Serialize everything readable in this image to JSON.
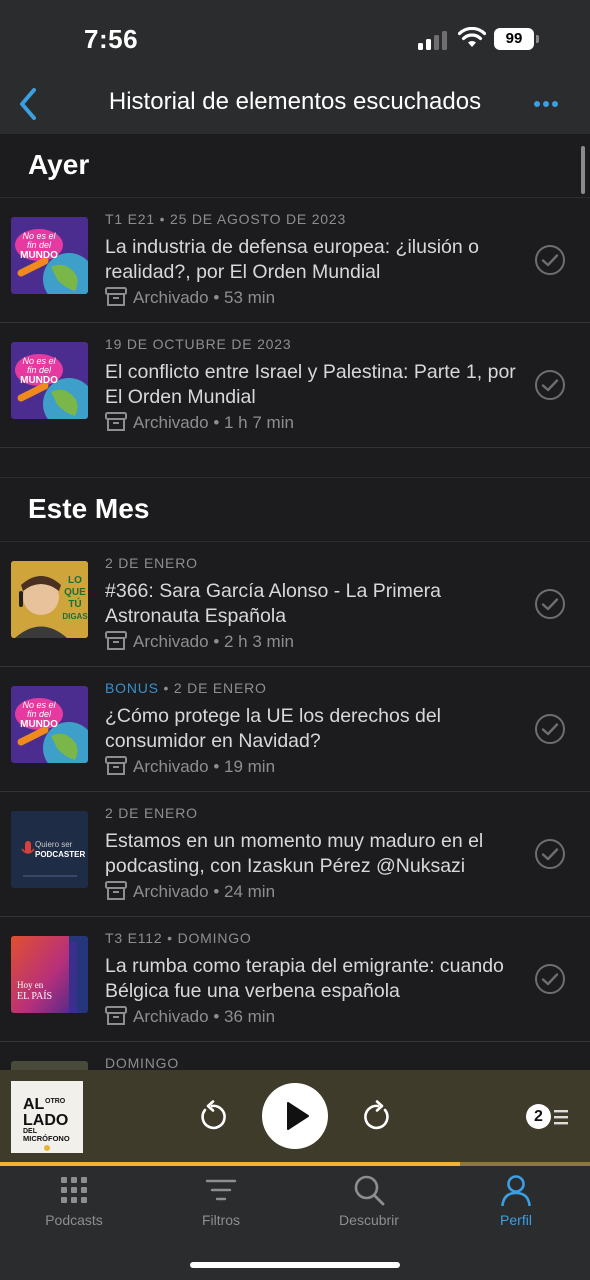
{
  "status_bar": {
    "time": "7:56",
    "battery": "99"
  },
  "header": {
    "title": "Historial de elementos escuchados"
  },
  "colors": {
    "accent": "#3b9fe3",
    "background": "#1c1c1e",
    "player_bg": "#3f3b2b",
    "progress": "#f2b233"
  },
  "sections": [
    {
      "title": "Ayer",
      "episodes": [
        {
          "meta": "T1 E21 • 25 DE AGOSTO DE 2023",
          "title": "La industria de defensa europea: ¿ilusión o realidad?, por El Orden Mundial",
          "status": "Archivado • 53 min",
          "artwork": "no-es-el-fin-del-mundo"
        },
        {
          "meta": "19 DE OCTUBRE DE 2023",
          "title": "El conflicto entre Israel y Palestina: Parte 1, por El Orden Mundial",
          "status": "Archivado • 1 h 7 min",
          "artwork": "no-es-el-fin-del-mundo"
        }
      ]
    },
    {
      "title": "Este Mes",
      "episodes": [
        {
          "meta": "2 DE ENERO",
          "title": "#366: Sara García Alonso - La Primera Astronauta Española",
          "status": "Archivado • 2 h 3 min",
          "artwork": "lo-que-tu-digas"
        },
        {
          "meta_prefix": "BONUS",
          "meta": " • 2 DE ENERO",
          "title": "¿Cómo protege la UE los derechos del consumidor en Navidad?",
          "status": "Archivado • 19 min",
          "artwork": "no-es-el-fin-del-mundo"
        },
        {
          "meta": "2 DE ENERO",
          "title": "Estamos en un momento muy maduro en el podcasting, con Izaskun Pérez @Nuksazi",
          "status": "Archivado • 24 min",
          "artwork": "quiero-ser-podcaster"
        },
        {
          "meta": "T3 E112 • DOMINGO",
          "title": "La rumba como terapia del emigrante: cuando Bélgica fue una verbena española",
          "status": "Archivado • 36 min",
          "artwork": "hoy-en-el-pais"
        },
        {
          "meta": "DOMINGO",
          "title": "",
          "status": "",
          "artwork": "partial"
        }
      ]
    }
  ],
  "artwork_text": {
    "fin_line1": "No es el",
    "fin_line2": "fin del",
    "fin_line3": "MUNDO",
    "lqtd": "LO QUE TÚ DIGAS",
    "quiero_small": "Quiero ser",
    "quiero_big": "PODCASTER",
    "pais_small": "Hoy en",
    "pais_big": "EL PAÍS",
    "mini_line1": "AL",
    "mini_line2": "OTRO",
    "mini_line3": "LADO",
    "mini_line4": "DEL",
    "mini_line5": "MICRÓFONO"
  },
  "player": {
    "progress_fraction": 0.78,
    "queue_count": "2"
  },
  "tabs": [
    {
      "label": "Podcasts",
      "icon": "grid-icon",
      "active": false
    },
    {
      "label": "Filtros",
      "icon": "filter-icon",
      "active": false
    },
    {
      "label": "Descubrir",
      "icon": "search-icon",
      "active": false
    },
    {
      "label": "Perfil",
      "icon": "profile-icon",
      "active": true
    }
  ]
}
